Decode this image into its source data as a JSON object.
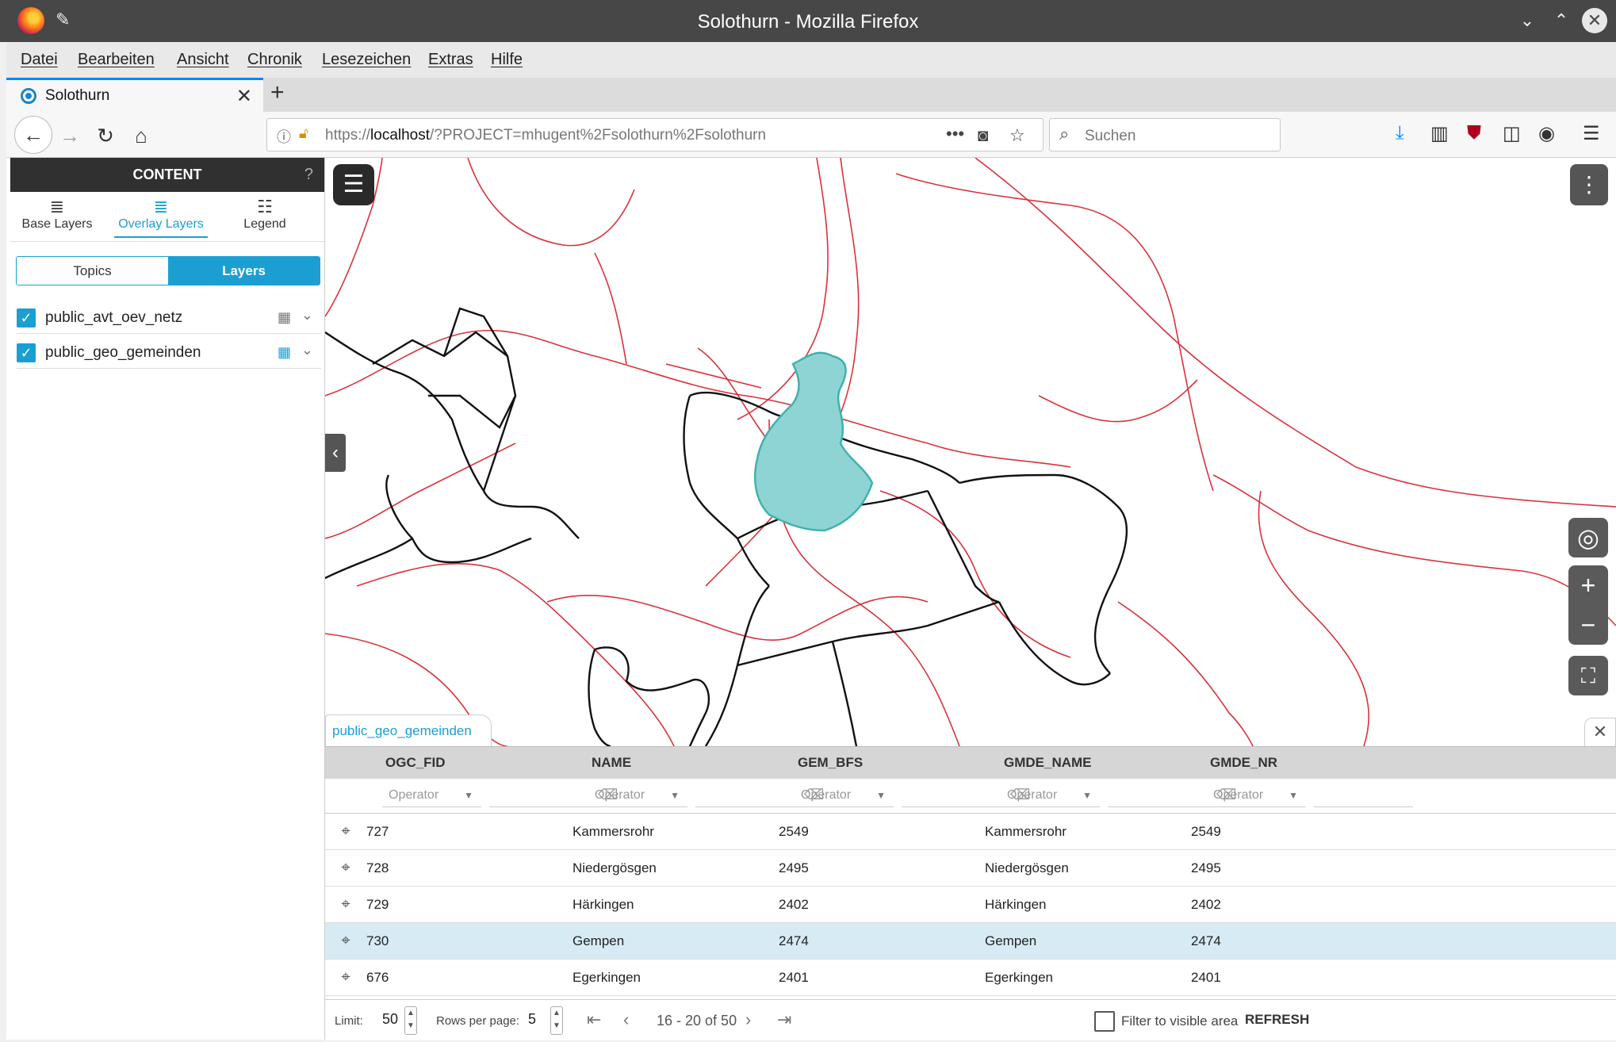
{
  "window": {
    "title": "Solothurn - Mozilla Firefox"
  },
  "menu": [
    "Datei",
    "Bearbeiten",
    "Ansicht",
    "Chronik",
    "Lesezeichen",
    "Extras",
    "Hilfe"
  ],
  "tab": {
    "title": "Solothurn"
  },
  "urlbar": {
    "prefix": "https://",
    "host": "localhost",
    "path": "/?PROJECT=mhugent%2Fsolothurn%2Fsolothurn"
  },
  "search": {
    "placeholder": "Suchen"
  },
  "sidebar": {
    "title": "CONTENT",
    "help": "?",
    "tabs": [
      "Base Layers",
      "Overlay Layers",
      "Legend"
    ],
    "segments": [
      "Topics",
      "Layers"
    ],
    "layers": [
      {
        "name": "public_avt_oev_netz",
        "checked": true
      },
      {
        "name": "public_geo_gemeinden",
        "checked": true
      }
    ]
  },
  "attribute_table": {
    "tab_label": "public_geo_gemeinden",
    "columns": [
      "OGC_FID",
      "NAME",
      "GEM_BFS",
      "GMDE_NAME",
      "GMDE_NR"
    ],
    "operator_placeholder": "Operator",
    "rows": [
      [
        "727",
        "Kammersrohr",
        "2549",
        "Kammersrohr",
        "2549"
      ],
      [
        "728",
        "Niedergösgen",
        "2495",
        "Niedergösgen",
        "2495"
      ],
      [
        "729",
        "Härkingen",
        "2402",
        "Härkingen",
        "2402"
      ],
      [
        "730",
        "Gempen",
        "2474",
        "Gempen",
        "2474"
      ],
      [
        "676",
        "Egerkingen",
        "2401",
        "Egerkingen",
        "2401"
      ]
    ],
    "selected_row": 3,
    "footer": {
      "limit_label": "Limit:",
      "limit": "50",
      "rows_per_page_label": "Rows per page:",
      "rows_per_page": "5",
      "page_info": "16 - 20 of 50",
      "filter_label": "Filter to visible area",
      "refresh": "REFRESH"
    }
  },
  "colors": {
    "accent": "#1b9fd3",
    "route": "#d9323d",
    "boundary": "#111111",
    "highlight_fill": "#8fd4d4",
    "highlight_stroke": "#3fb2ac"
  }
}
